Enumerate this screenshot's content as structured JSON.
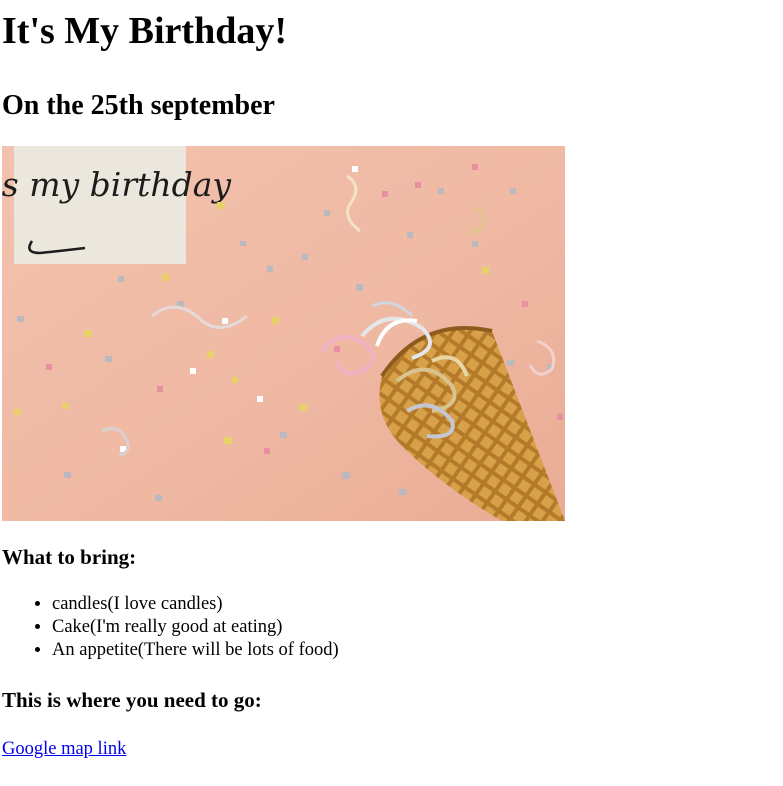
{
  "page": {
    "title": "It's My Birthday!",
    "subtitle": "On the 25th september"
  },
  "image": {
    "card_text": "it's my birthday",
    "icon": "birthday-photo"
  },
  "bring": {
    "heading": "What to bring:",
    "items": [
      "candles(I love candles)",
      "Cake(I'm really good at eating)",
      "An appetite(There will be lots of food)"
    ]
  },
  "directions": {
    "heading": "This is where you need to go:",
    "link_text": "Google map link"
  },
  "colors": {
    "background": "#ffffff",
    "photo_background": "#efb9a4",
    "link": "#0000ee"
  }
}
